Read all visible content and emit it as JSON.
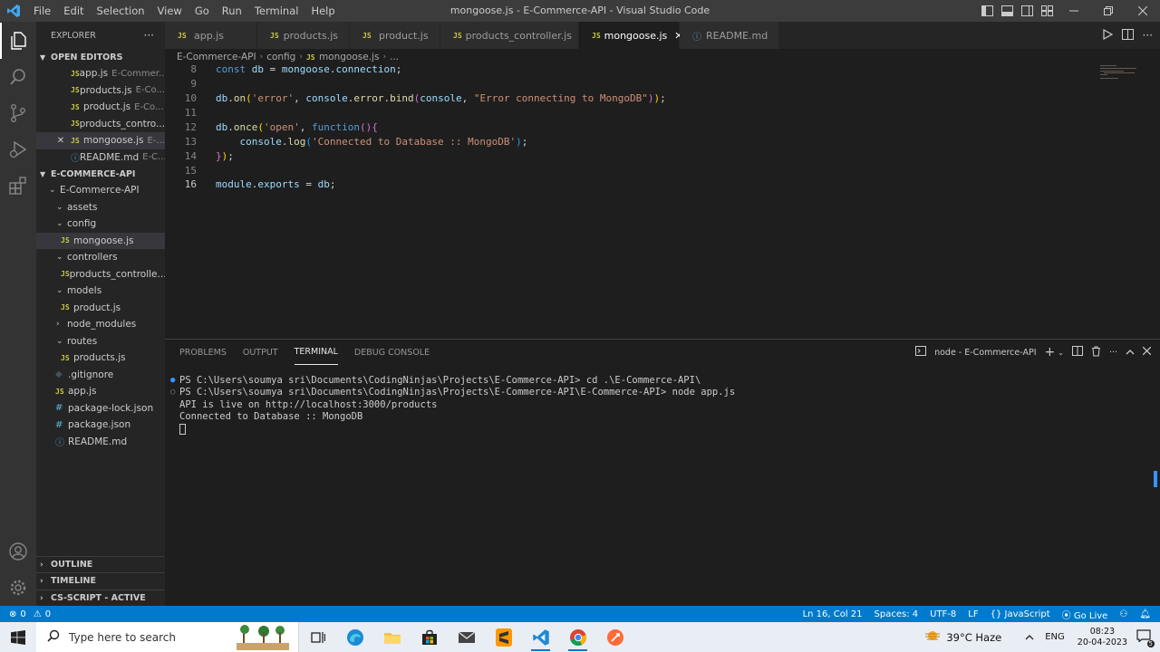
{
  "window": {
    "title": "mongoose.js - E-Commerce-API - Visual Studio Code",
    "menu": [
      "File",
      "Edit",
      "Selection",
      "View",
      "Go",
      "Run",
      "Terminal",
      "Help"
    ]
  },
  "sidebar": {
    "header": "EXPLORER",
    "more": "···",
    "open_editors_title": "OPEN EDITORS",
    "open_editors": [
      {
        "name": "app.js",
        "desc": "E-Commer..."
      },
      {
        "name": "products.js",
        "desc": "E-Co..."
      },
      {
        "name": "product.js",
        "desc": "E-Co..."
      },
      {
        "name": "products_contro...",
        "desc": ""
      },
      {
        "name": "mongoose.js",
        "desc": "E-..."
      },
      {
        "name": "README.md",
        "desc": "E-C..."
      }
    ],
    "project_title": "E-COMMERCE-API",
    "tree": {
      "root": "E-Commerce-API",
      "assets": "assets",
      "config": "config",
      "mongoose": "mongoose.js",
      "controllers": "controllers",
      "controller_file": "products_controlle...",
      "models": "models",
      "product": "product.js",
      "node_modules": "node_modules",
      "routes": "routes",
      "products": "products.js",
      "gitignore": ".gitignore",
      "app": "app.js",
      "package_lock": "package-lock.json",
      "package": "package.json",
      "readme": "README.md"
    },
    "outline": "OUTLINE",
    "timeline": "TIMELINE",
    "cs_script": "CS-SCRIPT - ACTIVE"
  },
  "tabs": [
    {
      "label": "app.js"
    },
    {
      "label": "products.js"
    },
    {
      "label": "product.js"
    },
    {
      "label": "products_controller.js"
    },
    {
      "label": "mongoose.js"
    },
    {
      "label": "README.md"
    }
  ],
  "breadcrumb": {
    "a": "E-Commerce-API",
    "b": "config",
    "c": "mongoose.js",
    "d": "..."
  },
  "editor": {
    "line_numbers": [
      "8",
      "9",
      "10",
      "11",
      "12",
      "13",
      "14",
      "15",
      "16"
    ],
    "line8": {
      "kw": "const",
      "var": "db",
      "eq": " = ",
      "obj": "mongoose",
      "dot": ".",
      "prop": "connection",
      "end": ";"
    },
    "line10": {
      "obj": "db",
      "dot": ".",
      "fn": "on",
      "open": "(",
      "s1": "'error'",
      "comma": ", ",
      "obj2": "console",
      "dot2": ".",
      "prop2": "error",
      "dot3": ".",
      "fn2": "bind",
      "open2": "(",
      "arg": "console",
      "comma2": ", ",
      "s2": "\"Error connecting to MongoDB\"",
      "close2": ")",
      "close": ")",
      "end": ";"
    },
    "line12": {
      "obj": "db",
      "dot": ".",
      "fn": "once",
      "open": "(",
      "s1": "'open'",
      "comma": ", ",
      "kw": "function",
      "paren": "()",
      "brace": "{"
    },
    "line13": {
      "indent": "    ",
      "obj": "console",
      "dot": ".",
      "fn": "log",
      "open": "(",
      "s1": "'Connected to Database :: MongoDB'",
      "close": ")",
      "end": ";"
    },
    "line14": {
      "brace": "}",
      "close": ")",
      "end": ";"
    },
    "line16": {
      "obj": "module",
      "dot": ".",
      "prop": "exports",
      "eq": " = ",
      "var": "db",
      "end": ";"
    }
  },
  "panel": {
    "tabs": [
      "PROBLEMS",
      "OUTPUT",
      "TERMINAL",
      "DEBUG CONSOLE"
    ],
    "terminal_name": "node - E-Commerce-API",
    "lines": [
      "PS C:\\Users\\soumya sri\\Documents\\CodingNinjas\\Projects\\E-Commerce-API> cd .\\E-Commerce-API\\",
      "PS C:\\Users\\soumya sri\\Documents\\CodingNinjas\\Projects\\E-Commerce-API\\E-Commerce-API> node app.js",
      "API is live on http://localhost:3000/products",
      "Connected to Database :: MongoDB"
    ]
  },
  "statusbar": {
    "errors": "0",
    "warnings": "0",
    "position": "Ln 16, Col 21",
    "spaces": "Spaces: 4",
    "encoding": "UTF-8",
    "eol": "LF",
    "language": "JavaScript",
    "golive": "Go Live"
  },
  "taskbar": {
    "search_placeholder": "Type here to search",
    "weather": "39°C  Haze",
    "lang": "ENG",
    "time": "08:23",
    "date": "20-04-2023",
    "notifications": "5"
  },
  "colors": {
    "accent": "#007acc",
    "js_icon": "#cbcb41",
    "string": "#ce9178",
    "keyword": "#569cd6"
  }
}
